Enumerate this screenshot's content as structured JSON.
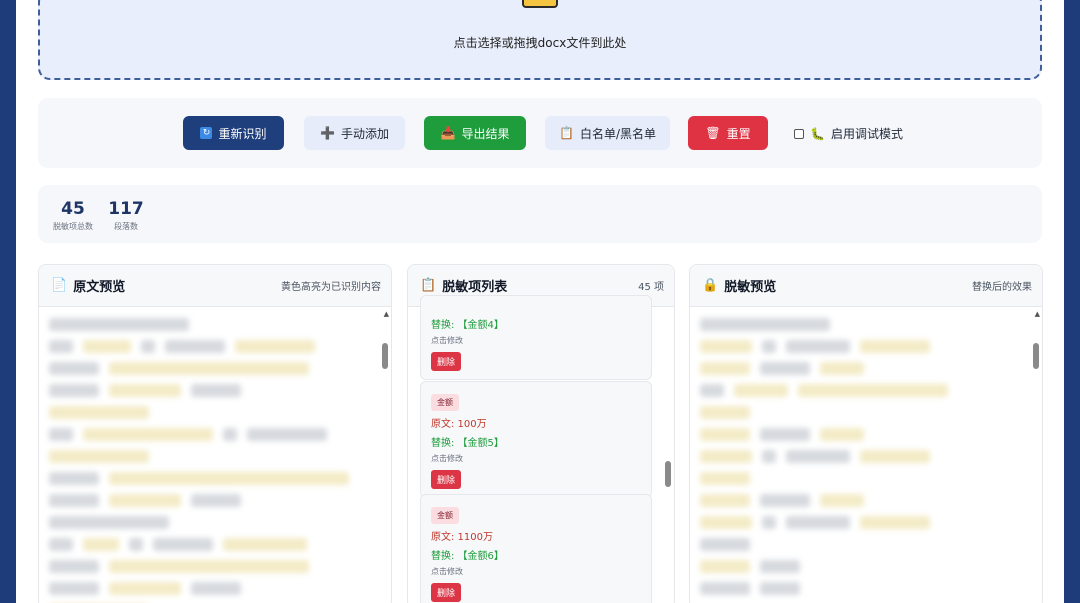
{
  "upload": {
    "text": "点击选择或拖拽docx文件到此处"
  },
  "toolbar": {
    "rescan_label": "重新识别",
    "add_label": "手动添加",
    "export_label": "导出结果",
    "list_label": "白名单/黑名单",
    "reset_label": "重置",
    "debug_label": "启用调试模式",
    "debug_checked": false
  },
  "stats": [
    {
      "value": "45",
      "label": "脱敏项总数"
    },
    {
      "value": "117",
      "label": "段落数"
    }
  ],
  "panels": {
    "original": {
      "icon": "📄",
      "title": "原文预览",
      "subtitle": "黄色高亮为已识别内容"
    },
    "list": {
      "icon": "📋",
      "title": "脱敏项列表",
      "subtitle": "45 项"
    },
    "masked": {
      "icon": "🔒",
      "title": "脱敏预览",
      "subtitle": "替换后的效果"
    }
  },
  "items": [
    {
      "replace": "替换: 【金额4】",
      "hint": "点击修改",
      "delete": "删除"
    },
    {
      "tag": "金额",
      "original": "原文: 100万",
      "replace": "替换: 【金额5】",
      "hint": "点击修改",
      "delete": "删除"
    },
    {
      "tag": "金额",
      "original": "原文: 1100万",
      "replace": "替换: 【金额6】",
      "hint": "点击修改",
      "delete": "删除"
    }
  ],
  "colors": {
    "background": "#1f3c7a",
    "primary": "#1f3f7c",
    "success": "#1f9d3d",
    "danger": "#df3344",
    "highlight": "#f3ebc6"
  }
}
